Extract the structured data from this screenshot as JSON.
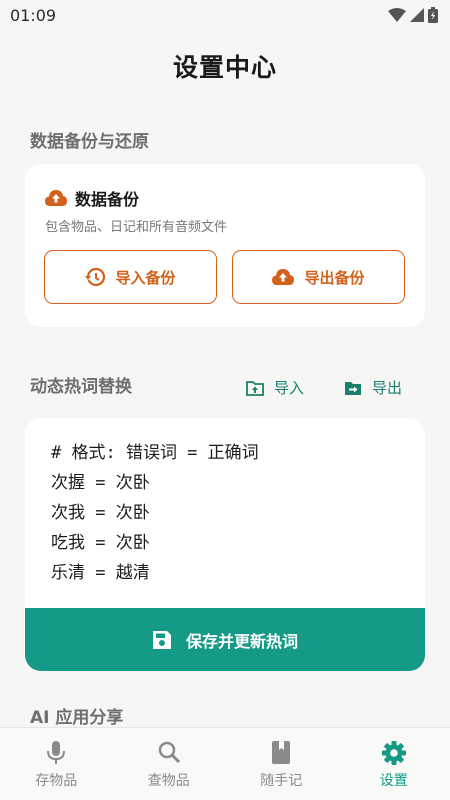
{
  "status": {
    "time": "01:09"
  },
  "page": {
    "title": "设置中心"
  },
  "backup_section": {
    "title": "数据备份与还原",
    "card_title": "数据备份",
    "description": "包含物品、日记和所有音频文件",
    "import_label": "导入备份",
    "export_label": "导出备份"
  },
  "hotword_section": {
    "title": "动态热词替换",
    "import_label": "导入",
    "export_label": "导出",
    "content": "# 格式: 错误词 = 正确词\n次握 = 次卧\n次我 = 次卧\n吃我 = 次卧\n乐清 = 越清",
    "save_label": "保存并更新热词"
  },
  "ai_section": {
    "title": "AI 应用分享"
  },
  "colors": {
    "accent": "#149a86",
    "orange": "#d2621b",
    "background": "#f6f6f4"
  },
  "nav": {
    "items": [
      {
        "label": "存物品",
        "icon": "mic-icon"
      },
      {
        "label": "查物品",
        "icon": "search-icon"
      },
      {
        "label": "随手记",
        "icon": "book-icon"
      },
      {
        "label": "设置",
        "icon": "gear-icon",
        "active": true
      }
    ]
  }
}
